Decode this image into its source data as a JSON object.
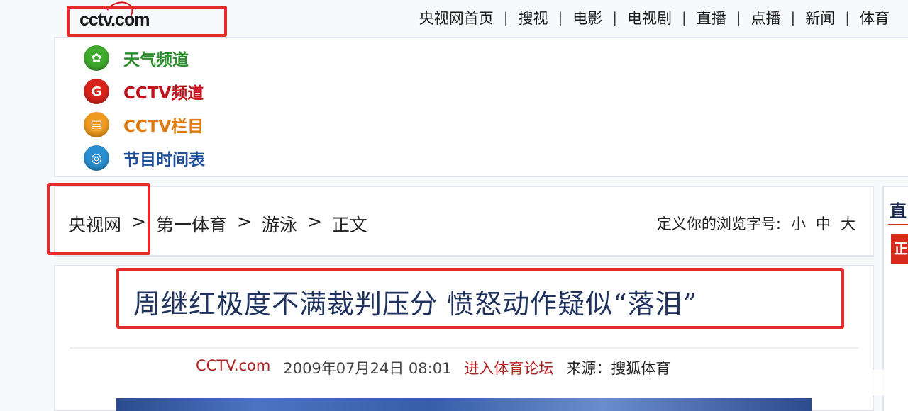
{
  "header": {
    "logo_text": "cctv.com",
    "nav": [
      "央视网首页",
      "搜视",
      "电影",
      "电视剧",
      "直播",
      "点播",
      "新闻",
      "体育"
    ],
    "nav_separator": "|"
  },
  "channels": [
    {
      "label": "天气频道",
      "icon": "weather-icon",
      "color": "#2a8f2a",
      "icon_color": "#3faa2e",
      "glyph": "✿"
    },
    {
      "label": "CCTV频道",
      "icon": "cctv-channel-icon",
      "color": "#c0141c",
      "icon_color": "#d8231c",
      "glyph": "G"
    },
    {
      "label": "CCTV栏目",
      "icon": "column-icon",
      "color": "#e07b10",
      "icon_color": "#f09a1e",
      "glyph": "▤"
    },
    {
      "label": "节目时间表",
      "icon": "schedule-icon",
      "color": "#1f4f9a",
      "icon_color": "#2a8fd0",
      "glyph": "◎"
    }
  ],
  "breadcrumb": {
    "items": [
      "央视网",
      "第一体育",
      "游泳",
      "正文"
    ],
    "separator": ">"
  },
  "font_size": {
    "label": "定义你的浏览字号:",
    "options": [
      "小",
      "中",
      "大"
    ]
  },
  "side_panel": {
    "text": "直",
    "red_text": "正"
  },
  "article": {
    "headline": "周继红极度不满裁判压分 愤怒动作疑似“落泪”",
    "source_site": "CCTV.com",
    "datetime": "2009年07月24日 08:01",
    "forum_link": "进入体育论坛",
    "origin": "来源：搜狐体育"
  },
  "highlight_color": "#e52a2a"
}
